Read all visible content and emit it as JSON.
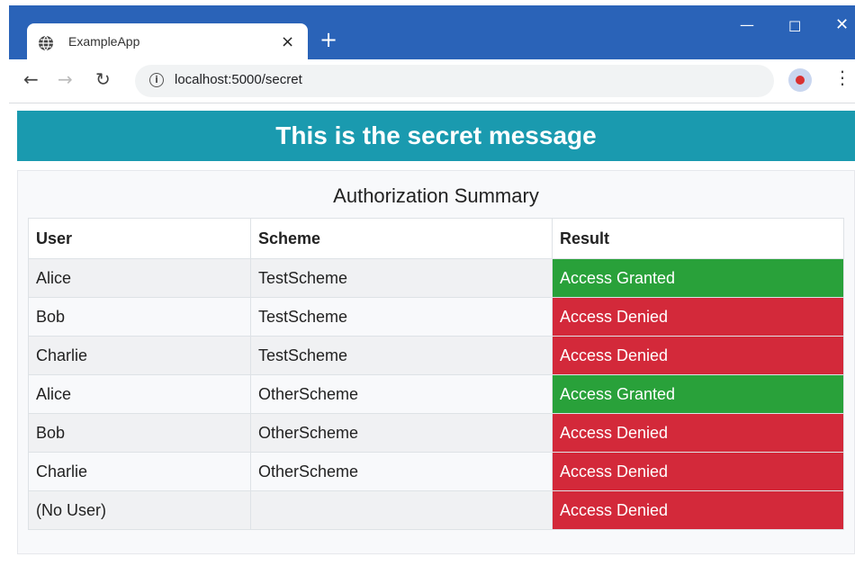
{
  "browser": {
    "tab_title": "ExampleApp",
    "tab_close": "×",
    "new_tab": "+",
    "url": "localhost:5000/secret",
    "icons": {
      "tab": "globe-icon",
      "back": "arrow-left-icon",
      "forward": "arrow-right-icon",
      "reload": "reload-icon",
      "info": "info-icon",
      "bookmark": "star-icon",
      "menu": "kebab-menu-icon"
    },
    "colors": {
      "titlebar": "#2a63b8"
    }
  },
  "page": {
    "banner": "This is the secret message",
    "banner_color": "#1a9aaf",
    "card_title": "Authorization Summary",
    "table": {
      "headers": [
        "User",
        "Scheme",
        "Result"
      ],
      "rows": [
        {
          "user": "Alice",
          "scheme": "TestScheme",
          "result": "Access Granted",
          "status": "granted"
        },
        {
          "user": "Bob",
          "scheme": "TestScheme",
          "result": "Access Denied",
          "status": "denied"
        },
        {
          "user": "Charlie",
          "scheme": "TestScheme",
          "result": "Access Denied",
          "status": "denied"
        },
        {
          "user": "Alice",
          "scheme": "OtherScheme",
          "result": "Access Granted",
          "status": "granted"
        },
        {
          "user": "Bob",
          "scheme": "OtherScheme",
          "result": "Access Denied",
          "status": "denied"
        },
        {
          "user": "Charlie",
          "scheme": "OtherScheme",
          "result": "Access Denied",
          "status": "denied"
        },
        {
          "user": "(No User)",
          "scheme": "",
          "result": "Access Denied",
          "status": "denied"
        }
      ]
    },
    "status_colors": {
      "granted": "#29a13a",
      "denied": "#d3293a"
    }
  }
}
